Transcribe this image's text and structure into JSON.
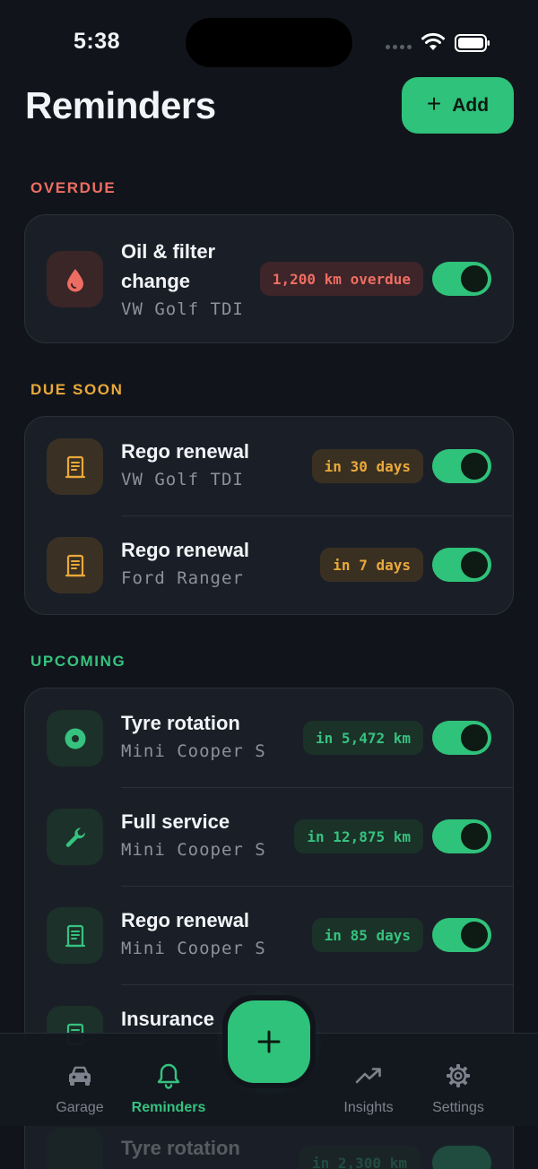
{
  "status_bar": {
    "time": "5:38"
  },
  "header": {
    "title": "Reminders",
    "add_label": "Add"
  },
  "sections": {
    "overdue": {
      "label": "OVERDUE",
      "items": [
        {
          "title_line1": "Oil & filter",
          "title_line2": "change",
          "vehicle": "VW Golf TDI",
          "badge": "1,200 km overdue",
          "icon": "oil-drop-icon",
          "enabled": true
        }
      ]
    },
    "due_soon": {
      "label": "DUE SOON",
      "items": [
        {
          "title": "Rego renewal",
          "vehicle": "VW Golf TDI",
          "badge": "in 30 days",
          "icon": "document-icon",
          "enabled": true
        },
        {
          "title": "Rego renewal",
          "vehicle": "Ford Ranger",
          "badge": "in 7 days",
          "icon": "document-icon",
          "enabled": true
        }
      ]
    },
    "upcoming": {
      "label": "UPCOMING",
      "items": [
        {
          "title": "Tyre rotation",
          "vehicle": "Mini Cooper S",
          "badge": "in 5,472 km",
          "icon": "tyre-icon",
          "enabled": true
        },
        {
          "title": "Full service",
          "vehicle": "Mini Cooper S",
          "badge": "in 12,875 km",
          "icon": "wrench-icon",
          "enabled": true
        },
        {
          "title": "Rego renewal",
          "vehicle": "Mini Cooper S",
          "badge": "in 85 days",
          "icon": "document-icon",
          "enabled": true
        },
        {
          "title": "Insurance",
          "icon": "document-icon"
        },
        {
          "title": "Tyre rotation",
          "badge": "in 2,300 km",
          "icon": "tyre-icon"
        }
      ]
    }
  },
  "tab_bar": {
    "tabs": [
      {
        "label": "Garage",
        "icon": "car-icon",
        "active": false
      },
      {
        "label": "Reminders",
        "icon": "bell-icon",
        "active": true
      },
      {
        "label": "Insights",
        "icon": "trend-up-icon",
        "active": false
      },
      {
        "label": "Settings",
        "icon": "gear-icon",
        "active": false
      }
    ],
    "fab_icon": "plus-icon"
  },
  "colors": {
    "background": "#11151b",
    "card": "#1a1f27",
    "accent_green": "#2fc27a",
    "overdue_red": "#ee6d62",
    "due_soon_amber": "#e9a93a"
  }
}
